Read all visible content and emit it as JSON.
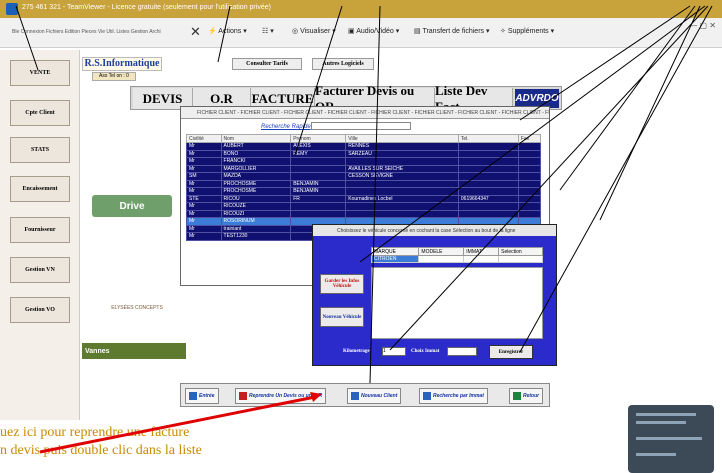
{
  "window": {
    "title": "275 461 321 - TeamViewer - Licence gratuite (seulement pour l'utilisation privée)"
  },
  "teamviewer_toolbar": {
    "menu": "Ble  Connexion  Fichiers  Edition  Pieces Vie  Util.  Listes  Gestion  Archi",
    "actions": "Actions",
    "view": "Visualiser",
    "audio_video": "Audio/Vidéo",
    "file_transfer": "Transfert de fichiers",
    "extras": "Suppléments"
  },
  "nav": {
    "items": [
      "VENTE",
      "Cpte Client",
      "STATS",
      "Encaissement",
      "Fournisseur",
      "Gestion VN",
      "Gestion VO"
    ]
  },
  "header": {
    "company": "R.S.Informatique",
    "assist": "Ass Tel on : 0",
    "btn_tarifs": "Consulter Tarifs",
    "btn_logiciels": "Autres Logiciels"
  },
  "main_tabs": [
    "DEVIS",
    "O.R",
    "FACTURE",
    "Facturer Devis ou OR",
    "Liste Dev Fact"
  ],
  "branding": {
    "drive": "Drive",
    "elysees": "ELYSÉES CONCEPTS",
    "location": "Vannes"
  },
  "client_grid": {
    "tab_strip": "FICHIER CLIENT - FICHIER CLIENT - FICHIER CLIENT - FICHIER CLIENT - FICHIER CLIENT - FICHIER CLIENT - FICHIER CLIENT - FICHIER CLIENT - FICHIER CL...",
    "search_label": "Recherche Rapide",
    "columns": [
      "Civilité",
      "Nom",
      "Prenom",
      "Ville",
      "Tel.",
      "Fax"
    ],
    "rows": [
      [
        "Mr",
        "AUBERT",
        "ALEXIS",
        "RENNES",
        "",
        ""
      ],
      [
        "Mr",
        "BONO",
        "REMY",
        "SARZEAU",
        "",
        ""
      ],
      [
        "Mr",
        "FRANCKI",
        "",
        "",
        "",
        ""
      ],
      [
        "Mr",
        "MARGOLLIER",
        "",
        "AVAILLES SUR SEICHE",
        "",
        ""
      ],
      [
        "SM",
        "MAZDA",
        "",
        "CESSON SEVIGNE",
        "",
        ""
      ],
      [
        "Mr",
        "PROCHOSME",
        "BENJAMIN",
        "",
        "",
        ""
      ],
      [
        "Mr",
        "PROCHOSME",
        "BENJAMIN",
        "",
        "",
        ""
      ],
      [
        "STE",
        "RICOU",
        "FR",
        "Kournadines Locbel",
        "0619664347",
        ""
      ],
      [
        "Mr",
        "RICOUZE",
        "",
        "",
        "",
        ""
      ],
      [
        "Mr",
        "RICOUZI",
        "",
        "",
        "",
        ""
      ],
      [
        "Mr",
        "ROSORINUM",
        "",
        "",
        "",
        ""
      ],
      [
        "Mr",
        "trainiant",
        "",
        "",
        "",
        ""
      ],
      [
        "Mr",
        "TEST1230",
        "",
        "",
        "",
        ""
      ]
    ],
    "selected_row": 10
  },
  "vehicle_dialog": {
    "title": "Choisissez le véhicule concerné en cochant la case Sélection au bout de la ligne",
    "columns": [
      "MARQUE",
      "MODELE",
      "IMMAT",
      "Selection"
    ],
    "rows": [
      [
        "CITROEN",
        "",
        "",
        ""
      ]
    ],
    "btn_keep": "Garder les Infos Véhicule",
    "btn_new": "Nouveau Véhicule",
    "km_label": "Kilometrage",
    "km_value": "1",
    "immat_label": "Choix Immat",
    "save": "Enregistrer"
  },
  "bottom_bar": {
    "entree": "Entrée",
    "reprendre": "Reprendre Un Devis ou un O.R",
    "nouveau_client": "Nouveau Client",
    "recherche_immat": "Recherche par Immat",
    "retour": "Retour"
  },
  "caption": {
    "line1": "uez ici pour reprendre une facture",
    "line2": "n devis puis double clic dans la liste"
  },
  "colors": {
    "title_bar": "#c8a23a",
    "grid_row": "#101070",
    "dialog_bg": "#2b2bcc",
    "arrow": "#000000",
    "red_arrow": "#e00000"
  }
}
